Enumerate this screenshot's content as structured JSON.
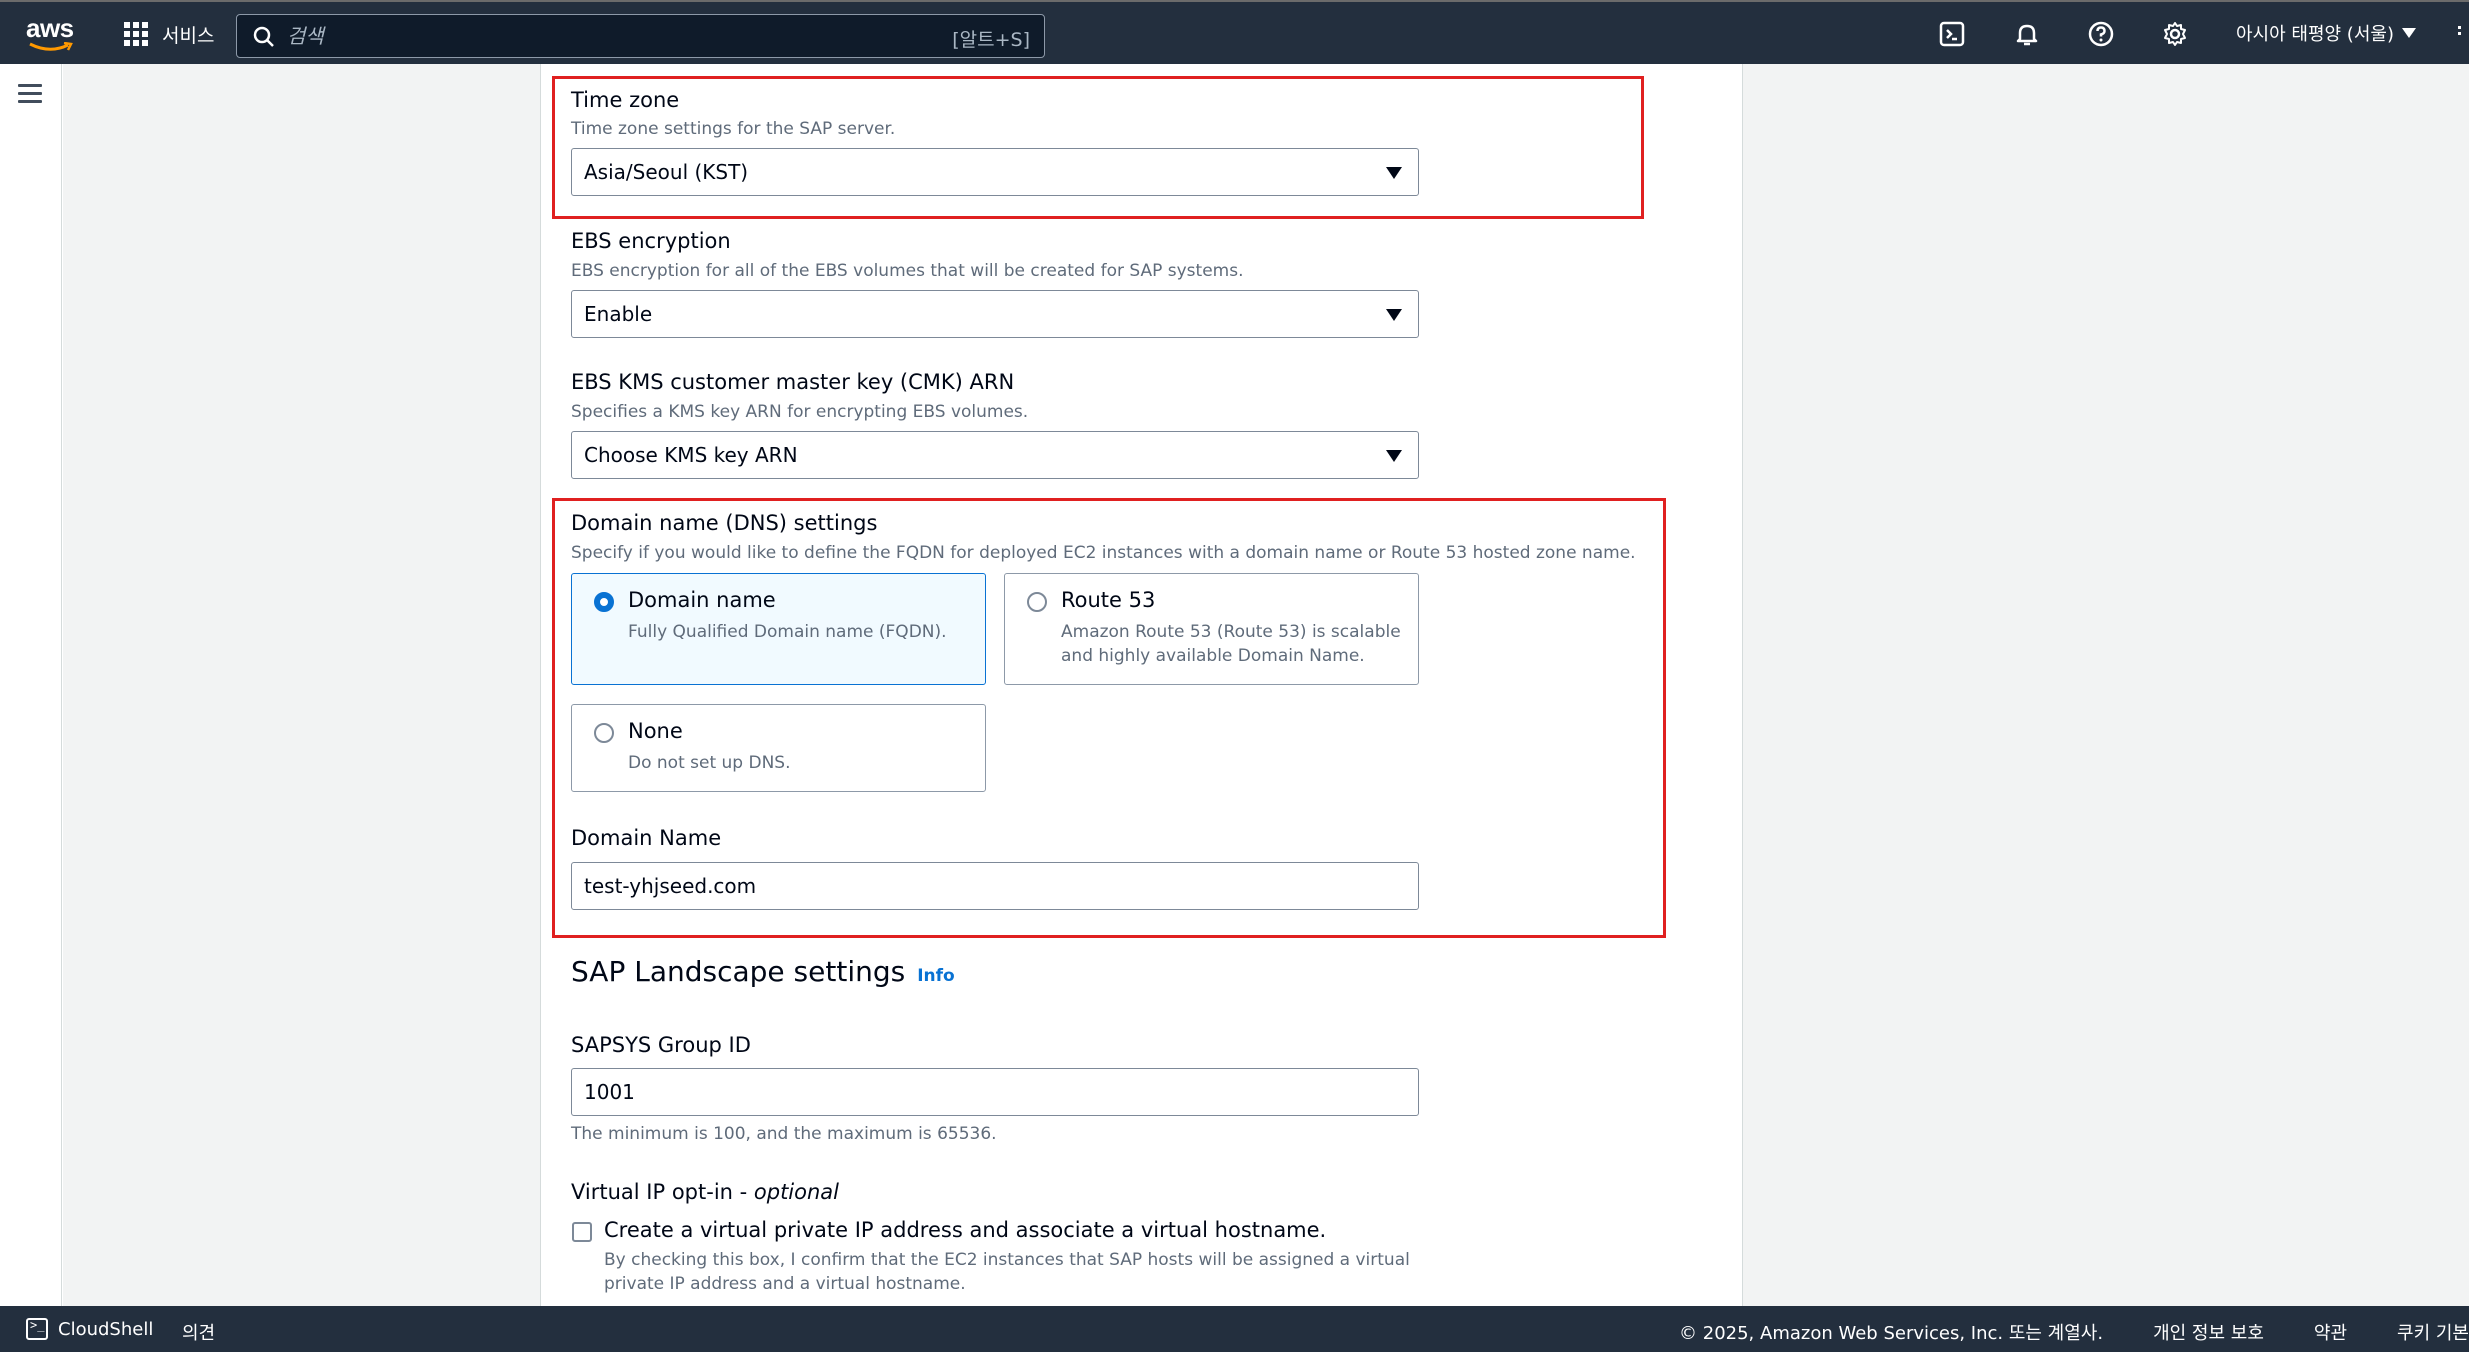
{
  "nav": {
    "logo_text": "aws",
    "services_label": "서비스",
    "search_placeholder": "검색",
    "search_shortcut": "[알트+S]",
    "region": "아시아 태평양 (서울)",
    "icons": [
      "cloudshell-icon",
      "bell-icon",
      "help-icon",
      "settings-icon"
    ]
  },
  "form": {
    "time_zone": {
      "label": "Time zone",
      "description": "Time zone settings for the SAP server.",
      "value": "Asia/Seoul (KST)"
    },
    "ebs_encryption": {
      "label": "EBS encryption",
      "description": "EBS encryption for all of the EBS volumes that will be created for SAP systems.",
      "value": "Enable"
    },
    "kms_key": {
      "label": "EBS KMS customer master key (CMK) ARN",
      "description": "Specifies a KMS key ARN for encrypting EBS volumes.",
      "value": "Choose KMS key ARN"
    },
    "dns": {
      "label": "Domain name (DNS) settings",
      "description": "Specify if you would like to define the FQDN for deployed EC2 instances with a domain name or Route 53 hosted zone name.",
      "options": [
        {
          "title": "Domain name",
          "desc": "Fully Qualified Domain name (FQDN).",
          "selected": true
        },
        {
          "title": "Route 53",
          "desc": "Amazon Route 53 (Route 53) is scalable and highly available Domain Name.",
          "selected": false
        },
        {
          "title": "None",
          "desc": "Do not set up DNS.",
          "selected": false
        }
      ],
      "domain_name_label": "Domain Name",
      "domain_name_value": "test-yhjseed.com"
    },
    "landscape": {
      "heading": "SAP Landscape settings",
      "info": "Info",
      "sapsys_label": "SAPSYS Group ID",
      "sapsys_value": "1001",
      "sapsys_hint": "The minimum is 100, and the maximum is 65536."
    },
    "virtual_ip": {
      "label": "Virtual IP opt-in - ",
      "optional": "optional",
      "checkbox_label": "Create a virtual private IP address and associate a virtual hostname.",
      "checkbox_desc_1": "By checking this box, I confirm that the EC2 instances that SAP hosts will be assigned a virtual",
      "checkbox_desc_2": "private IP address and a virtual hostname.",
      "checked": false
    }
  },
  "footer": {
    "cloudshell": "CloudShell",
    "feedback": "의견",
    "copyright": "© 2025, Amazon Web Services, Inc. 또는 계열사.",
    "privacy": "개인 정보 보호",
    "terms": "약관",
    "cookies": "쿠키 기본"
  },
  "colors": {
    "nav_bg": "#232f3e",
    "highlight_box": "#e02020",
    "selected_radio": "#0972d3",
    "selected_tile_bg": "#f1faff"
  }
}
